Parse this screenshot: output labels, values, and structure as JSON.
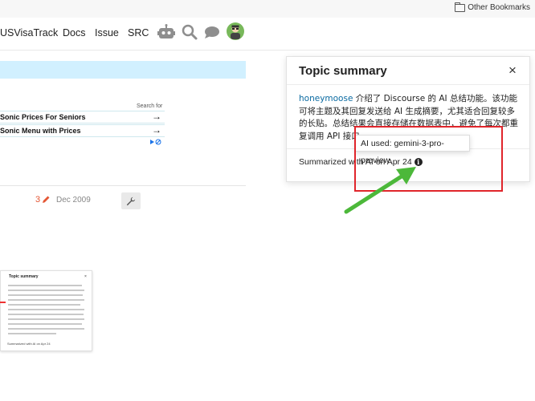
{
  "browser": {
    "other_bookmarks": "Other Bookmarks"
  },
  "header": {
    "nav": [
      {
        "label": "USVisaTrack"
      },
      {
        "label": "Docs"
      },
      {
        "label": "Issue"
      },
      {
        "label": "SRC"
      }
    ],
    "icons": [
      "robot-icon",
      "search-icon",
      "chat-icon",
      "avatar"
    ]
  },
  "main": {
    "ad": {
      "caption": "Search for",
      "items": [
        {
          "label": "Sonic Prices For Seniors"
        },
        {
          "label": "Sonic Menu with Prices"
        }
      ]
    },
    "post": {
      "like_count": "3",
      "date": "Dec 2009"
    },
    "thumbnail": {
      "title": "Topic summary",
      "close": "×",
      "footer": "Summarized with AI on Apr 24"
    }
  },
  "summary_panel": {
    "title": "Topic summary",
    "close": "×",
    "username": "honeymoose",
    "body": " 介绍了 Discourse 的 AI 总结功能。该功能可将主题及其回复发送给 AI 生成摘要，尤其适合回复较多的长贴。总结结果会直接存储在数据表中，避免了每次都重复调用 API 接口。",
    "footer": "Summarized with AI on Apr 24",
    "tooltip": "AI used: gemini-3-pro-preview"
  },
  "colors": {
    "accent_link": "#0a6aa1",
    "banner": "#d1f0ff",
    "highlight": "#e0252b",
    "arrow": "#4cb83a",
    "like": "#e45735"
  }
}
